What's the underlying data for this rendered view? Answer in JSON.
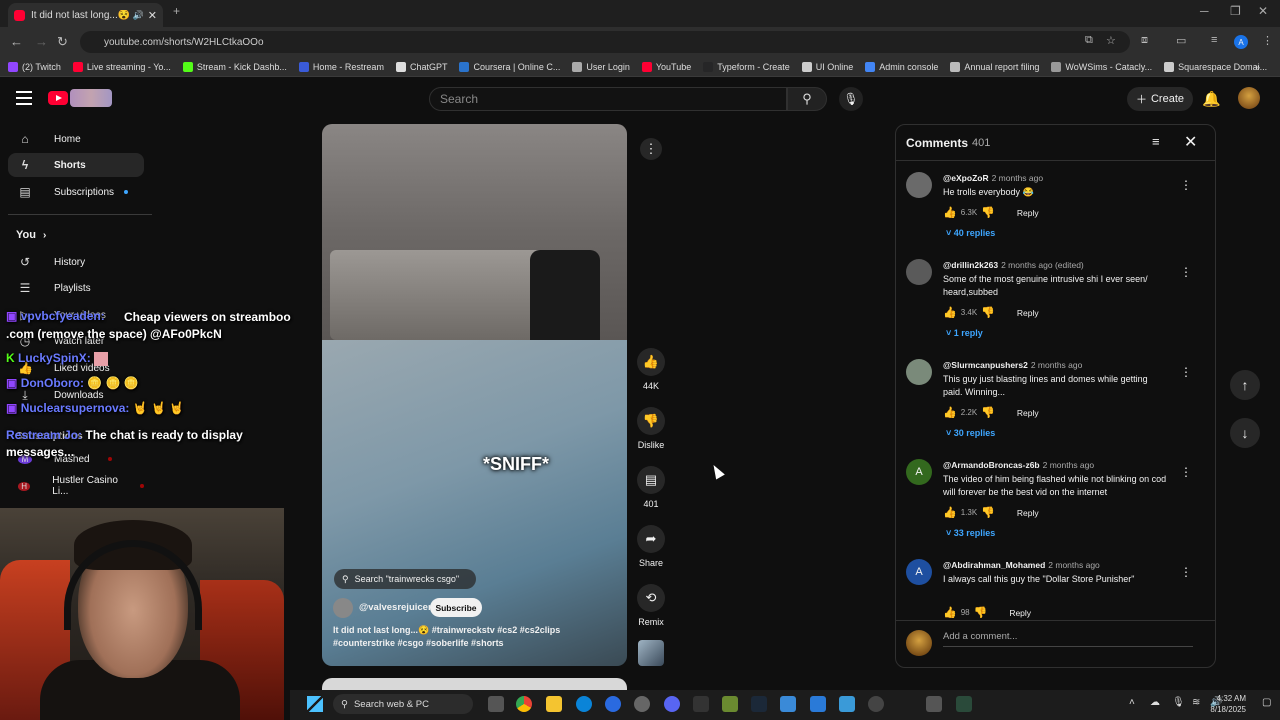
{
  "browser": {
    "tab_title": "It did not last long...😵 #tr",
    "url": "youtube.com/shorts/W2HLCtkaOOo",
    "bookmarks": [
      {
        "label": "(2) Twitch",
        "color": "#9146ff"
      },
      {
        "label": "Live streaming - Yo...",
        "color": "#ff0033"
      },
      {
        "label": "Stream - Kick Dashb...",
        "color": "#53fc18"
      },
      {
        "label": "Home - Restream",
        "color": "#3a5bd9"
      },
      {
        "label": "ChatGPT",
        "color": "#dddddd"
      },
      {
        "label": "Coursera | Online C...",
        "color": "#2a73cc"
      },
      {
        "label": "User Login",
        "color": "#aaaaaa"
      },
      {
        "label": "YouTube",
        "color": "#ff0033"
      },
      {
        "label": "Typeform - Create",
        "color": "#262627"
      },
      {
        "label": "UI Online",
        "color": "#cccccc"
      },
      {
        "label": "Admin console",
        "color": "#4285f4"
      },
      {
        "label": "Annual report filing",
        "color": "#bbbbbb"
      },
      {
        "label": "WoWSims - Catacly...",
        "color": "#999999"
      },
      {
        "label": "Squarespace Domai...",
        "color": "#cccccc"
      }
    ]
  },
  "header": {
    "search_placeholder": "Search",
    "create_label": "Create"
  },
  "sidebar": {
    "home": "Home",
    "shorts": "Shorts",
    "subscriptions": "Subscriptions",
    "you": "You",
    "history": "History",
    "playlists": "Playlists",
    "your_videos": "Your videos",
    "watch_later": "Watch later",
    "liked_videos": "Liked videos",
    "downloads": "Downloads",
    "subscriptions_section": "Subscriptions",
    "sub_mashed": "Mashed",
    "sub_hustler": "Hustler Casino Li..."
  },
  "chat_overlay": [
    {
      "user": "vpvbcfyeaden:",
      "msg": "Cheap viewers on streamboo .com (remove the space) @AFo0PkcN"
    },
    {
      "user": "LuckySpinX:",
      "msg": ""
    },
    {
      "user": "DonOboro:",
      "msg": "🪙 🪙 🪙"
    },
    {
      "user": "Nuclearsupernova:",
      "msg": "🤘 🤘 🤘"
    },
    {
      "user": "Restream Jo:",
      "msg": "The chat is ready to display messages..."
    }
  ],
  "video": {
    "overlay_text": "*SNIFF*",
    "search_chip": "Search \"trainwrecks csgo\"",
    "channel": "@valvesrejuicer",
    "subscribe": "Subscribe",
    "title": "It did not last long...😵 #trainwreckstv #cs2 #cs2clips #counterstrike #csgo #soberlife #shorts",
    "likes": "44K",
    "dislike": "Dislike",
    "comments": "401",
    "share": "Share",
    "remix": "Remix"
  },
  "comments_panel": {
    "title": "Comments",
    "count": "401",
    "add_comment": "Add a comment...",
    "items": [
      {
        "handle": "@eXpoZoR",
        "time": "2 months ago",
        "text": "He trolls everybody 😂",
        "likes": "6.3K",
        "reply": "Reply",
        "replies": "40 replies",
        "avatar": "#6a6a6a"
      },
      {
        "handle": "@drillin2k263",
        "time": "2 months ago (edited)",
        "text": "Some of the most genuine intrusive shi I ever seen/ heard,subbed",
        "likes": "3.4K",
        "reply": "Reply",
        "replies": "1 reply",
        "avatar": "#5a5a5a"
      },
      {
        "handle": "@Slurmcanpushers2",
        "time": "2 months ago",
        "text": "This guy just blasting lines and domes while getting paid. Winning...",
        "likes": "2.2K",
        "reply": "Reply",
        "replies": "30 replies",
        "avatar": "#7a8a7a"
      },
      {
        "handle": "@ArmandoBroncas-z6b",
        "time": "2 months ago",
        "text": "The video of him being flashed while not blinking on cod will forever be the best vid on the internet",
        "likes": "1.3K",
        "reply": "Reply",
        "replies": "33 replies",
        "avatar": "#33691e",
        "initial": "A"
      },
      {
        "handle": "@Abdirahman_Mohamed",
        "time": "2 months ago",
        "text": "I always call this guy the \"Dollar Store Punisher\"",
        "likes": "98",
        "reply": "Reply",
        "replies": "",
        "avatar": "#1e4fa0",
        "initial": "A"
      }
    ]
  },
  "taskbar": {
    "search": "Search web & PC",
    "time": "4:32 AM",
    "date": "8/18/2025"
  }
}
